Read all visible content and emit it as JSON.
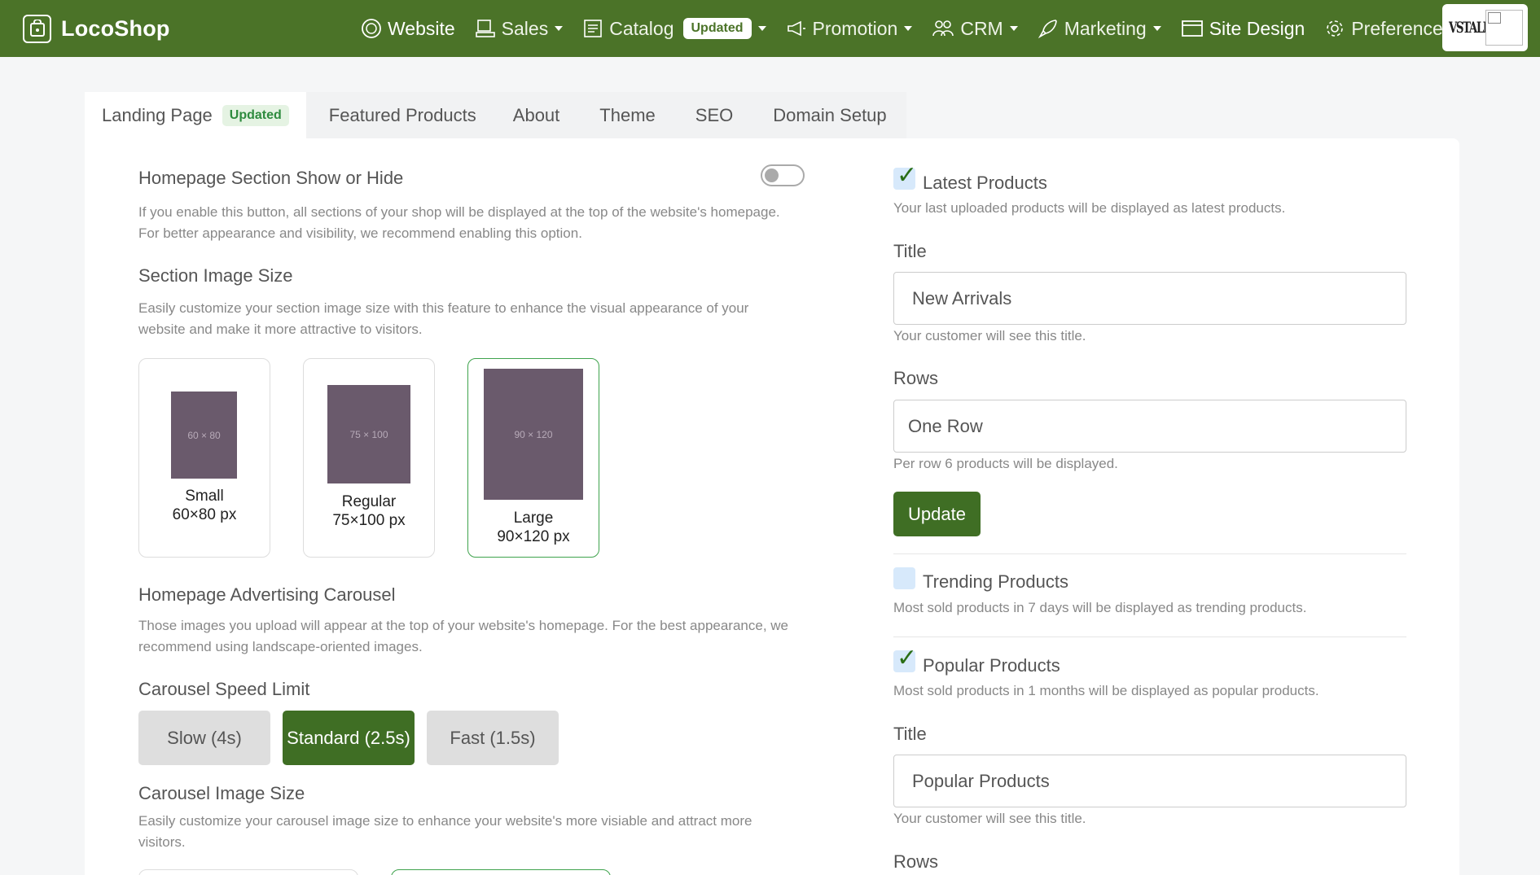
{
  "brand": {
    "name": "LocoShop"
  },
  "nav": {
    "website": "Website",
    "sales": "Sales",
    "catalog": "Catalog",
    "catalog_badge": "Updated",
    "promotion": "Promotion",
    "crm": "CRM",
    "marketing": "Marketing",
    "site_design": "Site Design",
    "preferences": "Preferences"
  },
  "avatar": {
    "signature": "VSTALIA"
  },
  "tabs": {
    "landing": "Landing Page",
    "landing_badge": "Updated",
    "featured": "Featured Products",
    "about": "About",
    "theme": "Theme",
    "seo": "SEO",
    "domain": "Domain Setup"
  },
  "left": {
    "section_toggle": {
      "title": "Homepage Section Show or Hide",
      "desc1": "If you enable this button, all sections of your shop will be displayed at the top of the website's homepage.",
      "desc2": "For better appearance and visibility, we recommend enabling this option.",
      "enabled": false
    },
    "section_image": {
      "title": "Section Image Size",
      "desc1": "Easily customize your section image size with this feature to enhance the visual appearance of your",
      "desc2": "website and make it more attractive to visitors.",
      "options": [
        {
          "thumb": "60 × 80",
          "name": "Small",
          "dims": "60×80 px"
        },
        {
          "thumb": "75 × 100",
          "name": "Regular",
          "dims": "75×100 px"
        },
        {
          "thumb": "90 × 120",
          "name": "Large",
          "dims": "90×120 px"
        }
      ],
      "selected": "Large"
    },
    "carousel": {
      "title": "Homepage Advertising Carousel",
      "desc1": "Those images you upload will appear at the top of your website's homepage. For the best appearance, we",
      "desc2": "recommend using landscape-oriented images."
    },
    "speed": {
      "title": "Carousel Speed Limit",
      "slow": "Slow (4s)",
      "standard": "Standard (2.5s)",
      "fast": "Fast (1.5s)",
      "selected": "Standard (2.5s)"
    },
    "carousel_image": {
      "title": "Carousel Image Size",
      "desc1": "Easily customize your carousel image size to enhance your website's more visiable and attract more",
      "desc2": "visitors."
    }
  },
  "right": {
    "latest": {
      "label": "Latest Products",
      "checked": true,
      "desc": "Your last uploaded products will be displayed as latest products.",
      "title_label": "Title",
      "title_value": "New Arrivals",
      "title_hint": "Your customer will see this title.",
      "rows_label": "Rows",
      "rows_value": "One Row",
      "rows_hint": "Per row 6 products will be displayed.",
      "update": "Update"
    },
    "trending": {
      "label": "Trending Products",
      "checked": false,
      "desc": "Most sold products in 7 days will be displayed as trending products."
    },
    "popular": {
      "label": "Popular Products",
      "checked": true,
      "desc": "Most sold products in 1 months will be displayed as popular products.",
      "title_label": "Title",
      "title_value": "Popular Products",
      "title_hint": "Your customer will see this title.",
      "rows_label": "Rows"
    }
  },
  "colors": {
    "brand": "#4b7328",
    "primary_button": "#3f6e24",
    "selected_border": "#3fa34d",
    "thumb": "#6a5a6c"
  }
}
